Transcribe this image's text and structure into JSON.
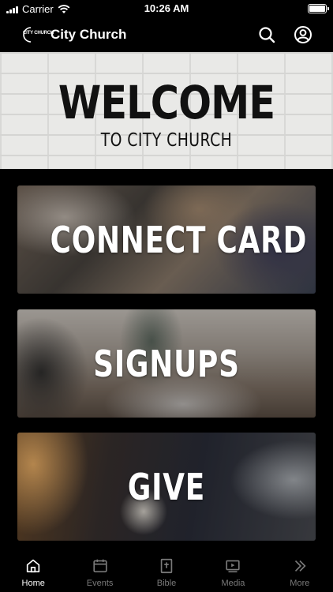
{
  "status_bar": {
    "carrier": "Carrier",
    "time": "10:26 AM"
  },
  "header": {
    "logo_text": "CITY CHURCH",
    "title": "City Church"
  },
  "welcome": {
    "title": "WELCOME",
    "subtitle": "TO CITY CHURCH"
  },
  "cards": [
    {
      "label": "CONNECT CARD"
    },
    {
      "label": "SIGNUPS"
    },
    {
      "label": "GIVE"
    }
  ],
  "tabs": [
    {
      "label": "Home",
      "icon": "home-icon",
      "active": true
    },
    {
      "label": "Events",
      "icon": "calendar-icon",
      "active": false
    },
    {
      "label": "Bible",
      "icon": "bible-icon",
      "active": false
    },
    {
      "label": "Media",
      "icon": "media-icon",
      "active": false
    },
    {
      "label": "More",
      "icon": "chevrons-right-icon",
      "active": false
    }
  ]
}
